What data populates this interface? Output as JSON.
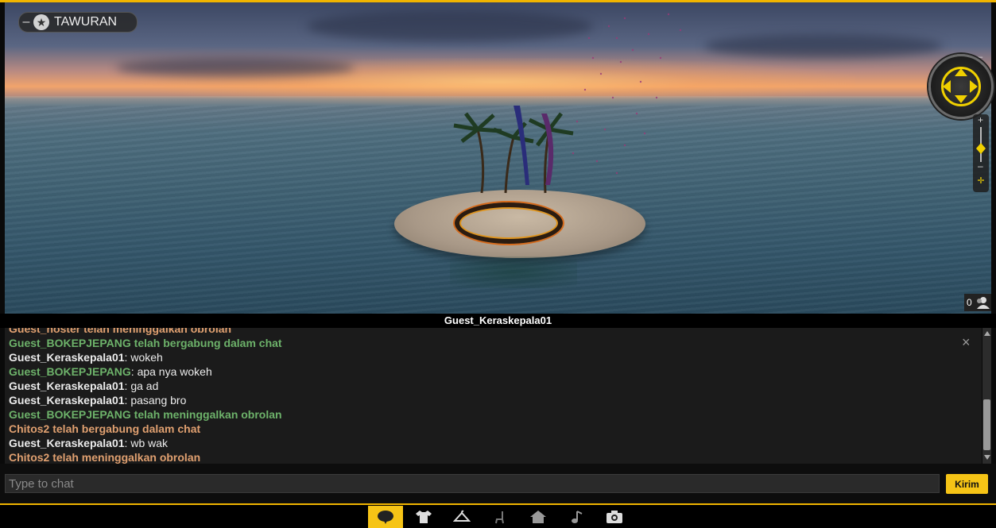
{
  "scene": {
    "area_name": "TAWURAN",
    "area_minus": "–",
    "area_star": "★",
    "user_count": "0"
  },
  "nav": {
    "collapse": "–",
    "zoom_in": "+",
    "zoom_out": "–",
    "fit": "✛"
  },
  "chat": {
    "title": "Guest_Keraskepala01",
    "close": "×",
    "lines": [
      {
        "name": "Guest_hoster",
        "text": "telah meninggalkan obrolan",
        "style": "orange"
      },
      {
        "name": "Guest_BOKEPJEPANG",
        "text": "telah bergabung dalam chat",
        "style": "green"
      },
      {
        "name": "Guest_Keraskepala01",
        "text": "wokeh",
        "style": "msg-white"
      },
      {
        "name": "Guest_BOKEPJEPANG",
        "text": "apa nya wokeh",
        "style": "msg-green"
      },
      {
        "name": "Guest_Keraskepala01",
        "text": "ga ad",
        "style": "msg-white"
      },
      {
        "name": "Guest_Keraskepala01",
        "text": "pasang bro",
        "style": "msg-white"
      },
      {
        "name": "Guest_BOKEPJEPANG",
        "text": "telah meninggalkan obrolan",
        "style": "green"
      },
      {
        "name": "Chitos2",
        "text": "telah bergabung dalam chat",
        "style": "orange"
      },
      {
        "name": "Guest_Keraskepala01",
        "text": "wb wak",
        "style": "msg-white"
      },
      {
        "name": "Chitos2",
        "text": "telah meninggalkan obrolan",
        "style": "orange"
      }
    ],
    "input_placeholder": "Type to chat",
    "send_label": "Kirim"
  },
  "toolbar": {
    "items": [
      "chat-icon",
      "tshirt-icon",
      "hanger-icon",
      "chair-icon",
      "home-icon",
      "music-icon",
      "camera-icon"
    ],
    "active": "chat-icon"
  },
  "colors": {
    "accent": "#f6c416",
    "join_leave_green": "#6db26a",
    "join_leave_orange": "#e0a070"
  }
}
